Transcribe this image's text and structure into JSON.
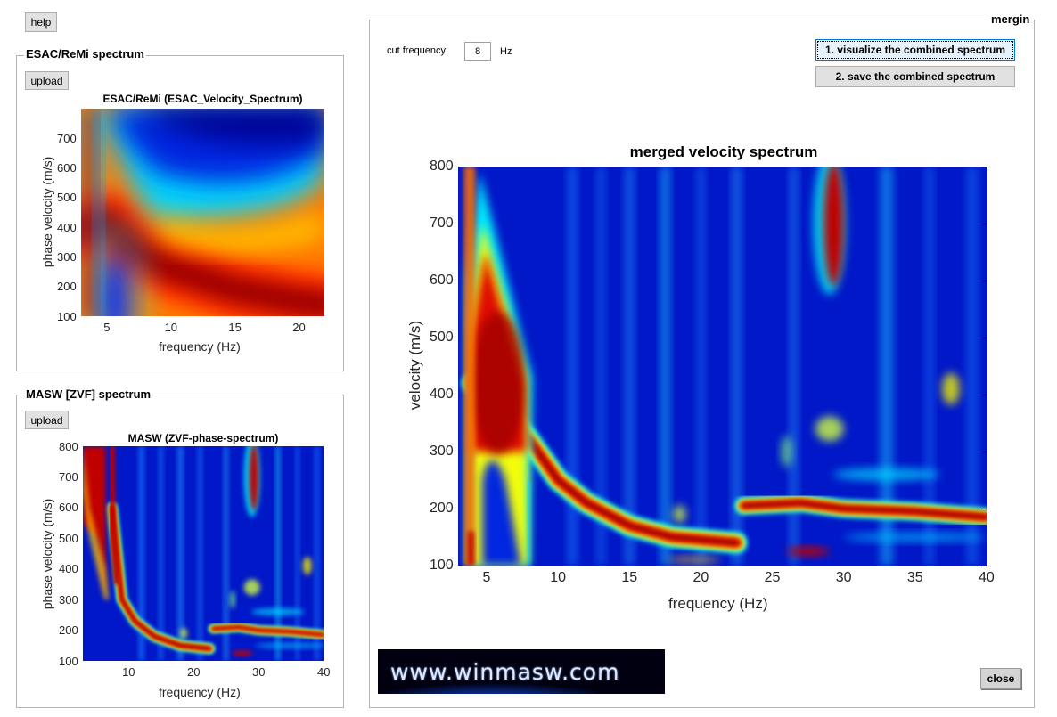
{
  "toolbar": {
    "help_label": "help"
  },
  "esac_panel": {
    "title": "ESAC/ReMi spectrum",
    "upload_label": "upload",
    "chart": {
      "title": "ESAC/ReMi (ESAC_Velocity_Spectrum)",
      "xlabel": "frequency (Hz)",
      "ylabel": "phase velocity (m/s)",
      "xticks": [
        "5",
        "10",
        "15",
        "20"
      ],
      "yticks": [
        "100",
        "200",
        "300",
        "400",
        "500",
        "600",
        "700"
      ]
    }
  },
  "masw_panel": {
    "title": "MASW [ZVF] spectrum",
    "upload_label": "upload",
    "chart": {
      "title": "MASW (ZVF-phase-spectrum)",
      "xlabel": "frequency (Hz)",
      "ylabel": "phase velocity (m/s)",
      "xticks": [
        "10",
        "20",
        "30",
        "40"
      ],
      "yticks": [
        "100",
        "200",
        "300",
        "400",
        "500",
        "600",
        "700",
        "800"
      ]
    }
  },
  "merge_panel": {
    "title": "mergin",
    "cut_frequency_label": "cut frequency:",
    "cut_frequency_value": "8",
    "cut_frequency_unit": "Hz",
    "visualize_label": "1. visualize the combined spectrum",
    "save_label": "2. save the combined spectrum",
    "close_label": "close",
    "logo_text": "www.winmasw.com",
    "chart": {
      "title": "merged velocity spectrum",
      "xlabel": "frequency (Hz)",
      "ylabel": "velocity (m/s)",
      "xticks": [
        "5",
        "10",
        "15",
        "20",
        "25",
        "30",
        "35",
        "40"
      ],
      "yticks": [
        "100",
        "200",
        "300",
        "400",
        "500",
        "600",
        "700",
        "800"
      ]
    }
  },
  "chart_data": [
    {
      "type": "heatmap",
      "title": "ESAC/ReMi (ESAC_Velocity_Spectrum)",
      "xlabel": "frequency (Hz)",
      "ylabel": "phase velocity (m/s)",
      "xlim": [
        3,
        22
      ],
      "ylim": [
        100,
        800
      ],
      "xticks": [
        5,
        10,
        15,
        20
      ],
      "yticks": [
        100,
        200,
        300,
        400,
        500,
        600,
        700
      ],
      "colormap": "jet",
      "ridge": {
        "x": [
          3.5,
          5,
          7,
          10,
          15,
          20,
          22
        ],
        "y": [
          400,
          420,
          330,
          260,
          190,
          150,
          140
        ]
      }
    },
    {
      "type": "heatmap",
      "title": "MASW (ZVF-phase-spectrum)",
      "xlabel": "frequency (Hz)",
      "ylabel": "phase velocity (m/s)",
      "xlim": [
        3,
        40
      ],
      "ylim": [
        100,
        800
      ],
      "xticks": [
        10,
        20,
        30,
        40
      ],
      "yticks": [
        100,
        200,
        300,
        400,
        500,
        600,
        700,
        800
      ],
      "colormap": "jet",
      "ridge": {
        "x": [
          7.5,
          9,
          11,
          14,
          18,
          22.5
        ],
        "y": [
          600,
          300,
          230,
          180,
          150,
          140
        ]
      },
      "higher_mode": {
        "x": [
          23,
          27,
          30,
          35,
          40
        ],
        "y": [
          205,
          210,
          200,
          195,
          185
        ]
      }
    },
    {
      "type": "heatmap",
      "title": "merged velocity spectrum",
      "xlabel": "frequency (Hz)",
      "ylabel": "velocity (m/s)",
      "xlim": [
        3,
        40
      ],
      "ylim": [
        100,
        800
      ],
      "xticks": [
        5,
        10,
        15,
        20,
        25,
        30,
        35,
        40
      ],
      "yticks": [
        100,
        200,
        300,
        400,
        500,
        600,
        700,
        800
      ],
      "colormap": "jet",
      "cut_frequency": 8,
      "ridge": {
        "x": [
          4,
          6,
          8,
          10,
          12,
          15,
          18,
          22.5
        ],
        "y": [
          420,
          380,
          320,
          250,
          210,
          170,
          150,
          140
        ]
      },
      "higher_mode": {
        "x": [
          23,
          27,
          30,
          35,
          40
        ],
        "y": [
          205,
          210,
          200,
          195,
          185
        ]
      }
    }
  ]
}
